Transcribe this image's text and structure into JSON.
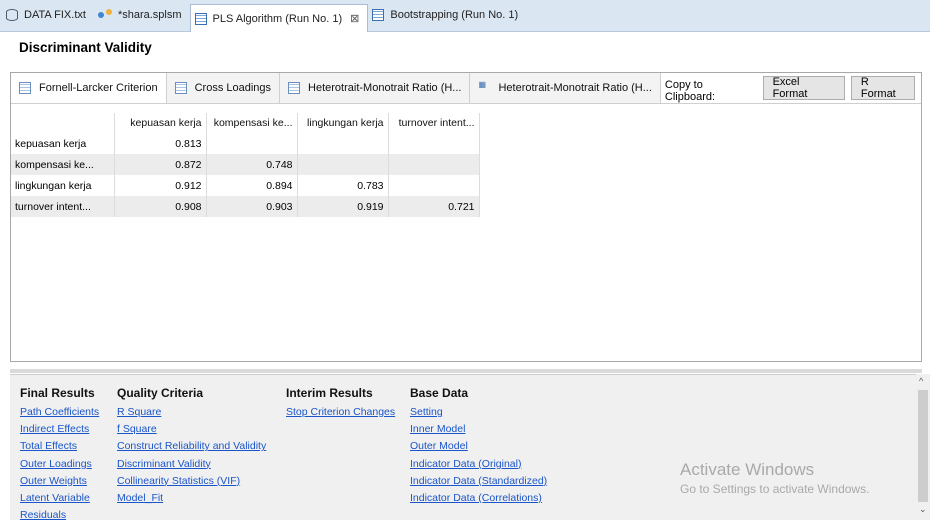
{
  "editor_tabs": [
    {
      "label": "DATA FIX.txt",
      "icon": "database-icon"
    },
    {
      "label": "*shara.splsm",
      "icon": "model-icon"
    },
    {
      "label": "PLS Algorithm (Run No. 1)",
      "icon": "report-icon",
      "close": "⊠"
    },
    {
      "label": "Bootstrapping (Run No. 1)",
      "icon": "report-icon"
    }
  ],
  "section_title": "Discriminant Validity",
  "view_tabs": [
    {
      "label": "Fornell-Larcker Criterion",
      "icon": "table-icon"
    },
    {
      "label": "Cross Loadings",
      "icon": "table-icon"
    },
    {
      "label": "Heterotrait-Monotrait Ratio (H...",
      "icon": "table-icon"
    },
    {
      "label": "Heterotrait-Monotrait Ratio (H...",
      "icon": "matrix-icon"
    }
  ],
  "clipboard": {
    "label": "Copy to Clipboard:",
    "excel": "Excel Format",
    "r": "R Format"
  },
  "matrix": {
    "columns": [
      "kepuasan kerja",
      "kompensasi ke...",
      "lingkungan kerja",
      "turnover intent..."
    ],
    "rows": [
      {
        "label": "kepuasan kerja",
        "values": [
          "0.813",
          "",
          "",
          ""
        ]
      },
      {
        "label": "kompensasi ke...",
        "values": [
          "0.872",
          "0.748",
          "",
          ""
        ]
      },
      {
        "label": "lingkungan kerja",
        "values": [
          "0.912",
          "0.894",
          "0.783",
          ""
        ]
      },
      {
        "label": "turnover intent...",
        "values": [
          "0.908",
          "0.903",
          "0.919",
          "0.721"
        ]
      }
    ]
  },
  "nav": {
    "final_results": {
      "title": "Final Results",
      "links": [
        "Path Coefficients",
        "Indirect Effects",
        "Total Effects",
        "Outer Loadings",
        "Outer Weights",
        "Latent Variable",
        "Residuals"
      ]
    },
    "quality_criteria": {
      "title": "Quality Criteria",
      "links": [
        "R Square",
        "f Square",
        "Construct Reliability and Validity",
        "Discriminant Validity",
        "Collinearity Statistics (VIF)",
        "Model_Fit"
      ]
    },
    "interim_results": {
      "title": "Interim Results",
      "links": [
        "Stop Criterion Changes"
      ]
    },
    "base_data": {
      "title": "Base Data",
      "links": [
        "Setting",
        "Inner Model",
        "Outer Model",
        "Indicator Data (Original)",
        "Indicator Data (Standardized)",
        "Indicator Data (Correlations)"
      ]
    }
  },
  "watermark": {
    "line1": "Activate Windows",
    "line2": "Go to Settings to activate Windows."
  },
  "scrollbar": {
    "up": "^",
    "down": "⌄"
  }
}
